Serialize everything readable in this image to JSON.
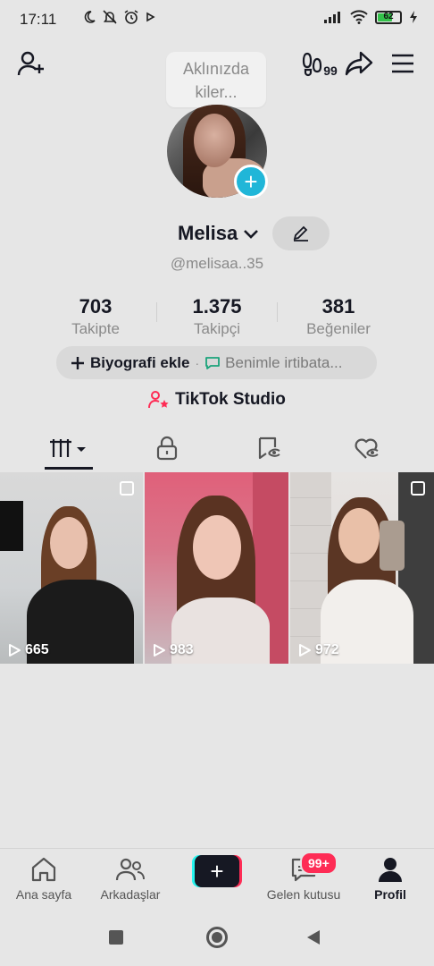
{
  "status_bar": {
    "time": "17:11",
    "battery": "62",
    "icons_left": [
      "moon-icon",
      "bell-off-icon",
      "alarm-icon",
      "play-icon"
    ],
    "icons_right": [
      "signal-icon",
      "wifi-icon",
      "battery-icon",
      "charging-icon"
    ]
  },
  "header": {
    "left_icon": "add-user-icon",
    "right_icons": [
      "footprints-icon",
      "share-icon",
      "menu-icon"
    ],
    "footprints_count": "99"
  },
  "tooltip": {
    "text": "Aklınızda kiler..."
  },
  "profile": {
    "name": "Melisa",
    "handle": "@melisaa..35"
  },
  "stats": [
    {
      "value": "703",
      "label": "Takipte"
    },
    {
      "value": "1.375",
      "label": "Takipçi"
    },
    {
      "value": "381",
      "label": "Beğeniler"
    }
  ],
  "bio": {
    "add_label": "Biyografi ekle",
    "separator": "·",
    "contact_label": "Benimle irtibata..."
  },
  "studio": {
    "label": "TikTok Studio"
  },
  "tabs": [
    "videos-tab",
    "private-tab",
    "reposts-tab",
    "liked-tab"
  ],
  "videos": [
    {
      "views": "665"
    },
    {
      "views": "983"
    },
    {
      "views": "972"
    }
  ],
  "bottom_nav": {
    "home": "Ana sayfa",
    "friends": "Arkadaşlar",
    "inbox": "Gelen kutusu",
    "inbox_badge": "99+",
    "profile": "Profil"
  },
  "colors": {
    "accent": "#fe2c55",
    "cyan": "#25f4ee",
    "add_blue": "#20b6d8",
    "text": "#161823",
    "muted": "#8a8a8a"
  }
}
